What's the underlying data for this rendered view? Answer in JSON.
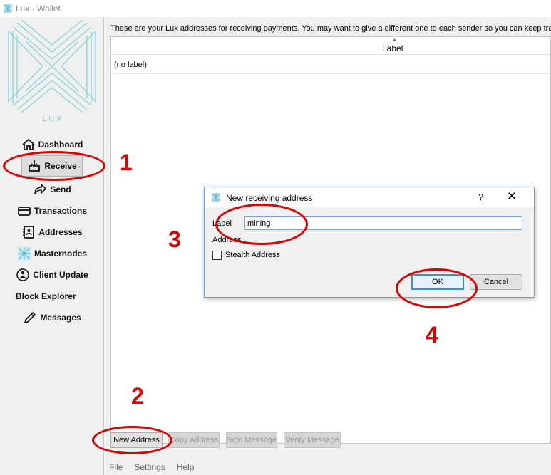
{
  "window": {
    "title": "Lux - Wallet",
    "icon": "lux-icon"
  },
  "sidebar": {
    "logo_text": "L U X",
    "items": [
      {
        "label": "Dashboard",
        "icon": "home-icon"
      },
      {
        "label": "Receive",
        "icon": "receive-icon",
        "active": true
      },
      {
        "label": "Send",
        "icon": "send-arrow-icon"
      },
      {
        "label": "Transactions",
        "icon": "card-icon"
      },
      {
        "label": "Addresses",
        "icon": "address-book-icon"
      },
      {
        "label": "Masternodes",
        "icon": "masternode-icon"
      },
      {
        "label": "Client Update",
        "icon": "update-user-icon"
      },
      {
        "label": "Block Explorer",
        "icon": ""
      },
      {
        "label": "Messages",
        "icon": "pen-icon"
      }
    ]
  },
  "main": {
    "description": "These are your Lux addresses for receiving payments. You may want to give a different one to each sender so you can keep track",
    "table": {
      "columns": [
        "Label"
      ],
      "rows": [
        {
          "label": "(no label)"
        }
      ]
    },
    "buttons": {
      "new_address": "New Address",
      "copy_address": "Copy Address",
      "sign_message": "Sign Message",
      "verify_message": "Verify Message"
    }
  },
  "menubar": {
    "items": [
      "File",
      "Settings",
      "Help"
    ]
  },
  "dialog": {
    "title": "New receiving address",
    "help": "?",
    "close": "✕",
    "label_text": "Label",
    "label_value": "mining",
    "address_text": "Address",
    "stealth_label": "Stealth Address",
    "stealth_checked": false,
    "ok": "OK",
    "cancel": "Cancel"
  },
  "annotations": {
    "color": "#e00000",
    "numbers": [
      "1",
      "2",
      "3",
      "4"
    ]
  }
}
